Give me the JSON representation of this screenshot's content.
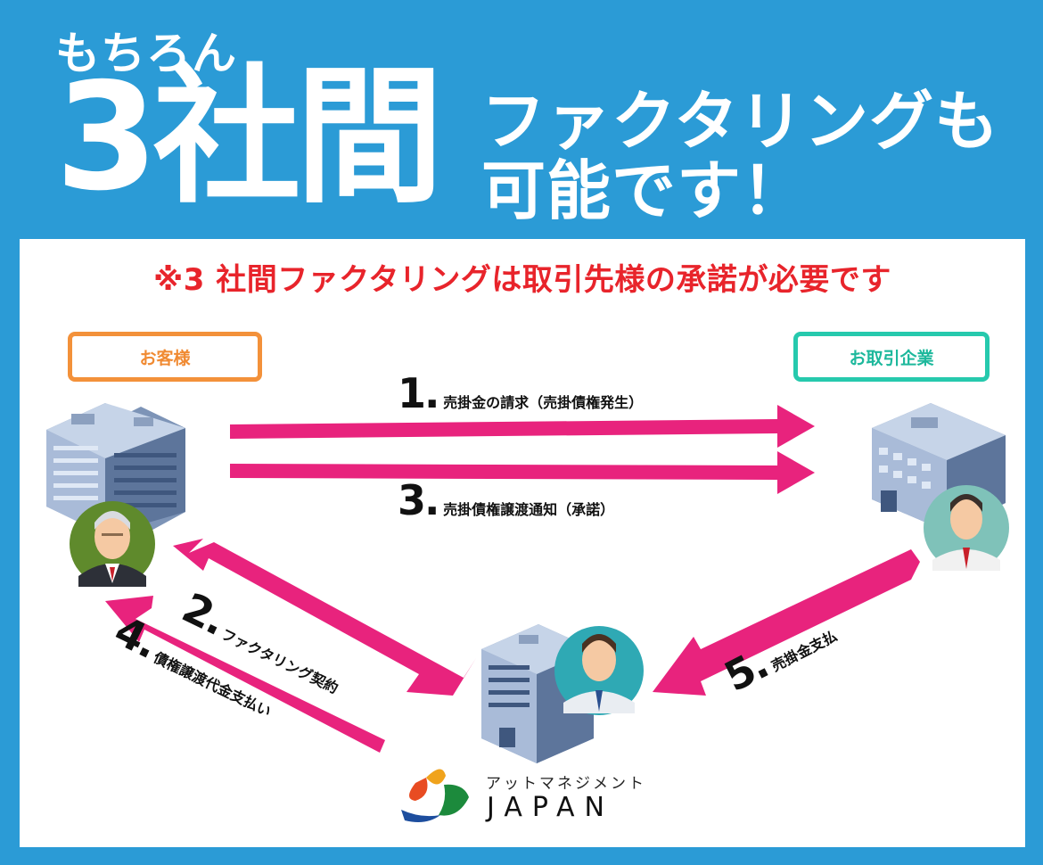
{
  "header": {
    "intro": "もちろん",
    "big": "3社間",
    "line1": "ファクタリングも",
    "line2": "可能です！"
  },
  "notice": "※3 社間ファクタリングは取引先様の承諾が必要です",
  "parties": {
    "customer": "お客様",
    "partner": "お取引企業"
  },
  "steps": [
    {
      "num": "1.",
      "text": "売掛金の請求（売掛債権発生）"
    },
    {
      "num": "2.",
      "text": "ファクタリング契約"
    },
    {
      "num": "3.",
      "text": "売掛債権譲渡通知（承諾）"
    },
    {
      "num": "4.",
      "text": "債権譲渡代金支払い"
    },
    {
      "num": "5.",
      "text": "売掛金支払"
    }
  ],
  "logo": {
    "katakana": "アットマネジメント",
    "name": "JAPAN"
  },
  "colors": {
    "background": "#2b9bd6",
    "arrow": "#e8237d",
    "notice": "#e8242b",
    "customer_tag": "#f3913a",
    "partner_tag": "#26c9ad"
  }
}
